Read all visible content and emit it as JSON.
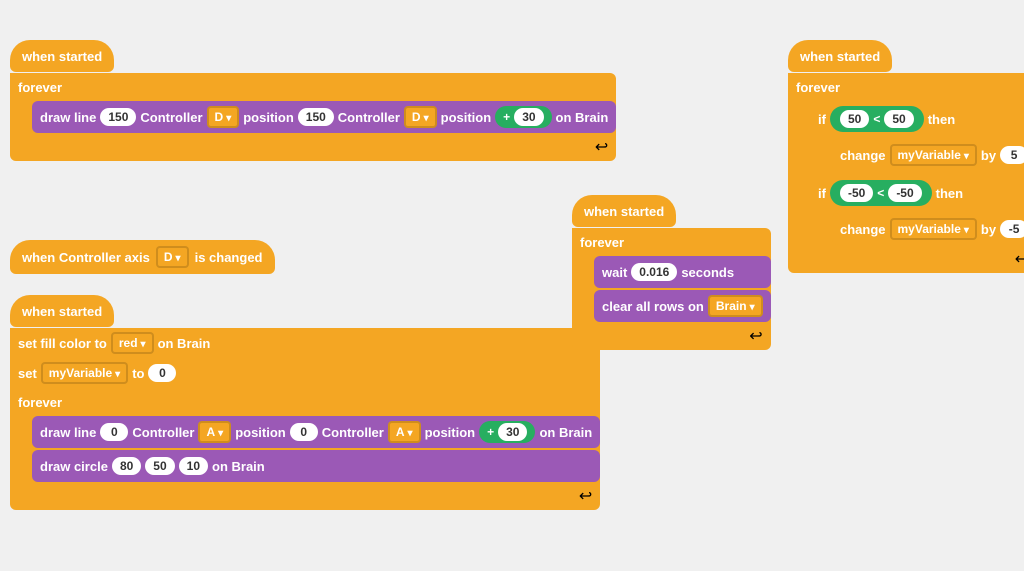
{
  "colors": {
    "orange": "#f4a623",
    "purple": "#9b59b6",
    "green": "#27ae60",
    "darkOrange": "#e6a800"
  },
  "block1": {
    "hat": "when started",
    "forever": "forever",
    "drawLine": {
      "label": "draw line",
      "val1": "150",
      "ctrl1": "Controller",
      "dir1": "D",
      "pos1": "position",
      "val2": "150",
      "ctrl2": "Controller",
      "dir2": "D",
      "pos2": "position",
      "plus": "+",
      "val3": "30",
      "onBrain": "on Brain"
    }
  },
  "block2": {
    "hat": "when Controller axis",
    "dropdown": "D",
    "isChanged": "is changed"
  },
  "block3": {
    "hat": "when started",
    "setFill": "set fill color to",
    "color": "red",
    "onBrain": "on Brain",
    "setVar": "set",
    "variable": "myVariable",
    "to": "to",
    "val": "0",
    "forever": "forever",
    "drawLine": {
      "label": "draw line",
      "val1": "0",
      "ctrl1": "Controller",
      "dir1": "A",
      "pos1": "position",
      "val2": "0",
      "ctrl2": "Controller",
      "dir2": "A",
      "pos2": "position",
      "plus": "+",
      "val3": "30",
      "onBrain": "on Brain"
    },
    "drawCircle": {
      "label": "draw circle",
      "val1": "80",
      "val2": "50",
      "val3": "10",
      "onBrain": "on Brain"
    }
  },
  "block4": {
    "hat": "when started",
    "forever": "forever",
    "wait": "wait",
    "seconds_val": "0.016",
    "seconds": "seconds",
    "clearAllRows": "clear all rows on",
    "brain": "Brain"
  },
  "block5": {
    "hat": "when started",
    "forever": "forever",
    "if1": {
      "label": "if",
      "val1": "50",
      "op": "<",
      "val2": "50",
      "then": "then"
    },
    "change1": {
      "label": "change",
      "variable": "myVariable",
      "by": "by",
      "val": "5"
    },
    "if2": {
      "label": "if",
      "val1": "-50",
      "op": "<",
      "val2": "-50",
      "then": "then"
    },
    "change2": {
      "label": "change",
      "variable": "myVariable",
      "by": "by",
      "val": "-5"
    }
  }
}
